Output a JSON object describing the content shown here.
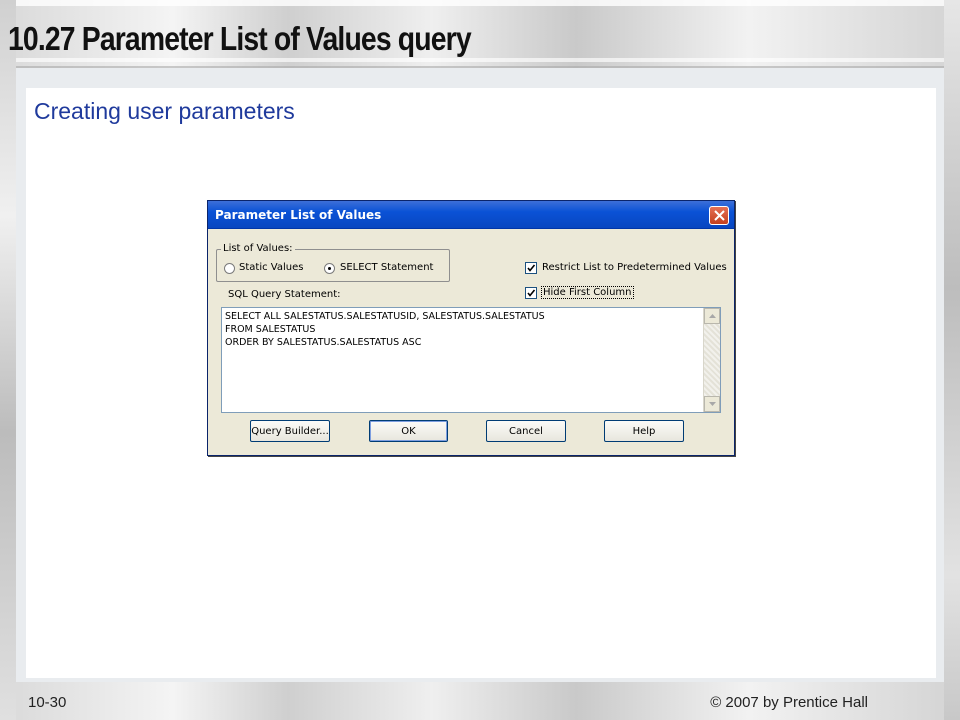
{
  "slide": {
    "title": "10.27 Parameter List of Values query",
    "subtitle": "Creating user parameters",
    "footer_left": "10-30",
    "footer_right": "© 2007 by Prentice Hall"
  },
  "dialog": {
    "title": "Parameter List of Values",
    "list_of_values_label": "List of Values:",
    "radio_static": {
      "label": "Static Values",
      "selected": false
    },
    "radio_select": {
      "label": "SELECT Statement",
      "selected": true
    },
    "checkbox_restrict": {
      "label": "Restrict List to Predetermined Values",
      "checked": true
    },
    "checkbox_hide": {
      "label": "Hide First Column",
      "checked": true
    },
    "sql_label": "SQL Query Statement:",
    "sql_lines": [
      "SELECT ALL  SALESTATUS.SALESTATUSID, SALESTATUS.SALESTATUS",
      "FROM SALESTATUS",
      "ORDER BY SALESTATUS.SALESTATUS ASC"
    ],
    "buttons": {
      "query_builder": "Query Builder...",
      "ok": "OK",
      "cancel": "Cancel",
      "help": "Help"
    }
  },
  "colors": {
    "subtitle": "#1f3a9c",
    "titlebar": "#0a52d6",
    "dialog_bg": "#ece9d8"
  }
}
